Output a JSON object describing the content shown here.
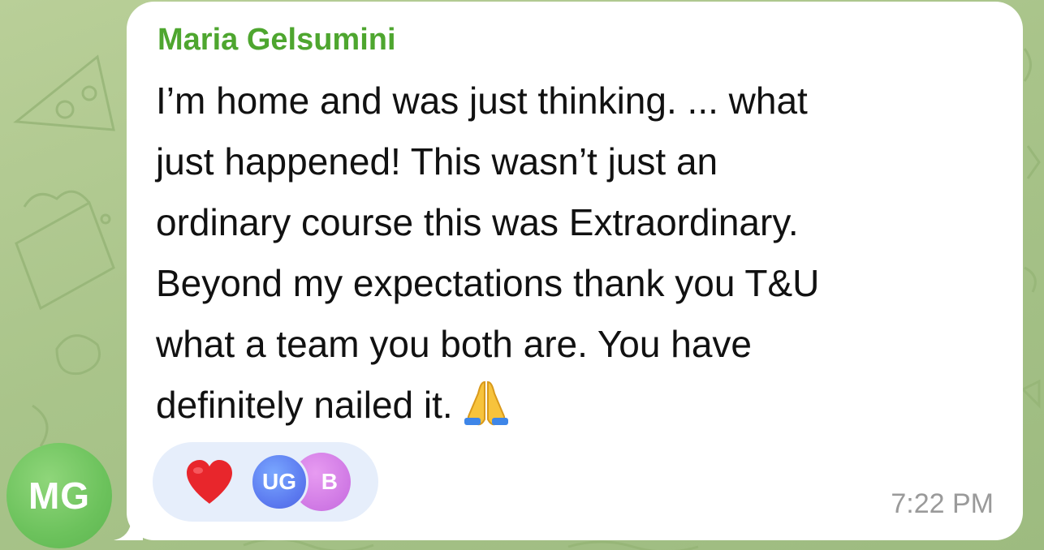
{
  "chat": {
    "avatar_initials": "MG",
    "message": {
      "sender": "Maria Gelsumini",
      "lines": [
        "I’m home and was just thinking. ... what",
        "just happened! This wasn’t just an",
        "ordinary course this was Extraordinary.",
        "Beyond my expectations thank you T&U",
        "what a team you both are. You have",
        "definitely nailed it."
      ],
      "trailing_emoji": "folded-hands-icon",
      "time": "7:22 PM",
      "reaction": {
        "emoji": "heart-icon",
        "users": [
          "UG",
          "B"
        ]
      }
    }
  },
  "colors": {
    "sender": "#4ea62f",
    "avatar": "#6cc25c",
    "heart": "#e8262c",
    "reaction_pill": "#e6eefb",
    "badge_ug": "#5b79ef",
    "badge_b": "#cf78e4"
  }
}
